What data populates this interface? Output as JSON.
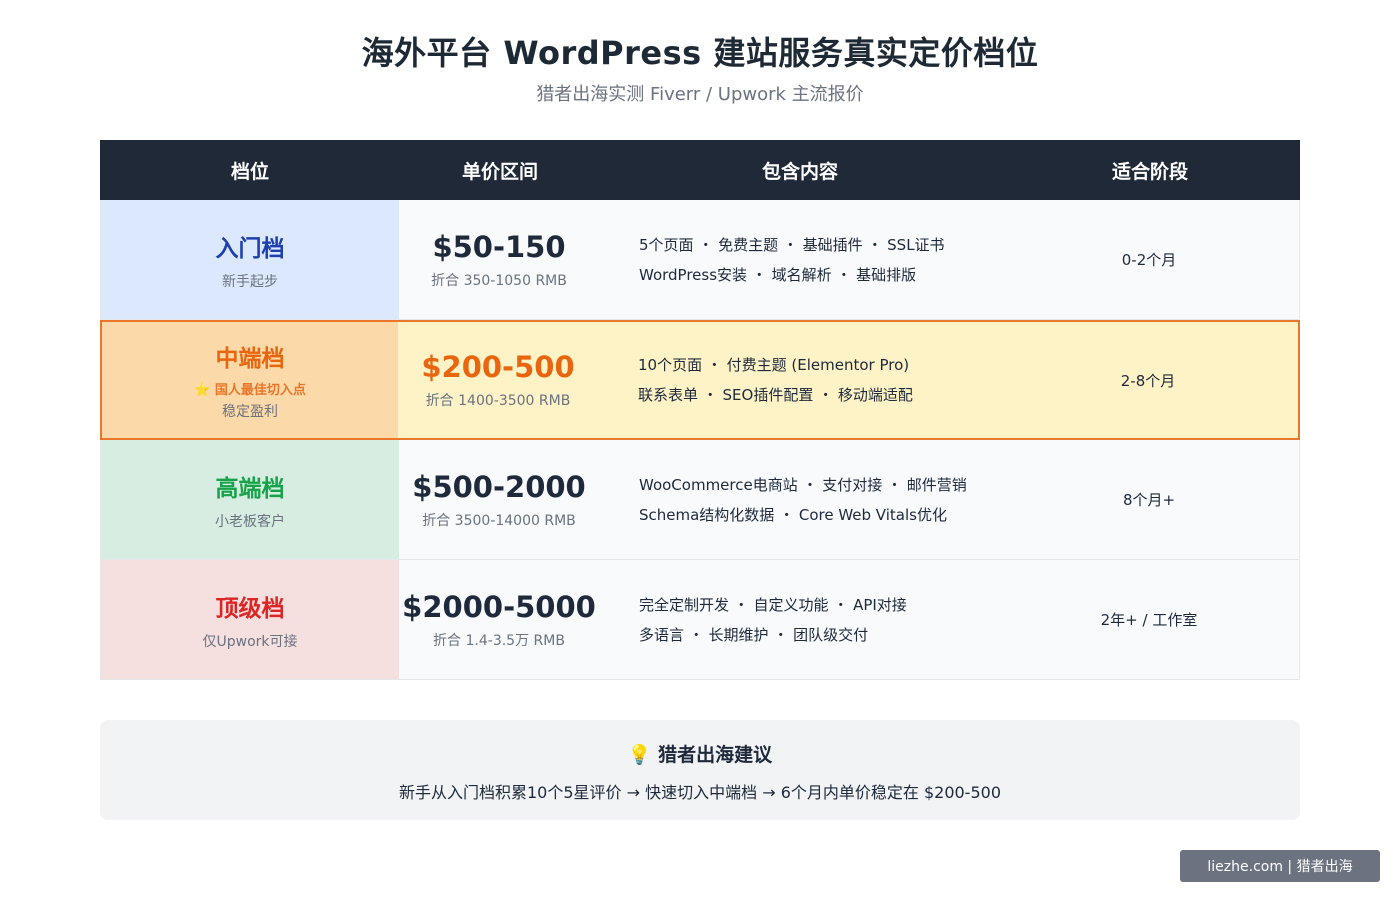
{
  "page": {
    "title": "海外平台 WordPress 建站服务真实定价档位",
    "subtitle": "猎者出海实测 Fiverr / Upwork 主流报价"
  },
  "table": {
    "headers": [
      "档位",
      "单价区间",
      "包含内容",
      "适合阶段"
    ],
    "rows": [
      {
        "tier": "入门档",
        "tier_color": "#1e40af",
        "tier_bg": "#dbe8fd",
        "note": "新手起步",
        "tag": "",
        "price": "$50-150",
        "price_color": "#1e293b",
        "rmb": "折合 350-1050 RMB",
        "lines": [
          "5个页面 ・ 免费主题 ・ 基础插件 ・ SSL证书",
          "WordPress安装 ・ 域名解析 ・ 基础排版"
        ],
        "stage": "0-2个月"
      },
      {
        "tier": "中端档",
        "tier_color": "#e8660f",
        "tier_bg": "#fcd9a8",
        "note": "稳定盈利",
        "tag": "⭐ 国人最佳切入点",
        "price": "$200-500",
        "price_color": "#e8660f",
        "rmb": "折合 1400-3500 RMB",
        "lines": [
          "10个页面 ・ 付费主题 (Elementor Pro)",
          "联系表单 ・ SEO插件配置 ・ 移动端适配"
        ],
        "stage": "2-8个月"
      },
      {
        "tier": "高端档",
        "tier_color": "#16a34a",
        "tier_bg": "#d7ede1",
        "note": "小老板客户",
        "tag": "",
        "price": "$500-2000",
        "price_color": "#1e293b",
        "rmb": "折合 3500-14000 RMB",
        "lines": [
          "WooCommerce电商站 ・ 支付对接 ・ 邮件营销",
          "Schema结构化数据 ・ Core Web Vitals优化"
        ],
        "stage": "8个月+"
      },
      {
        "tier": "顶级档",
        "tier_color": "#dc2626",
        "tier_bg": "#f5dfdf",
        "note": "仅Upwork可接",
        "tag": "",
        "price": "$2000-5000",
        "price_color": "#1e293b",
        "rmb": "折合 1.4-3.5万 RMB",
        "lines": [
          "完全定制开发 ・ 自定义功能 ・ API对接",
          "多语言 ・ 长期维护 ・ 团队级交付"
        ],
        "stage": "2年+ / 工作室"
      }
    ]
  },
  "tip": {
    "title": "💡 猎者出海建议",
    "body": "新手从入门档积累10个5星评价 → 快速切入中端档 → 6个月内单价稳定在 $200-500"
  },
  "badge": {
    "text": "liezhe.com | 猎者出海"
  }
}
